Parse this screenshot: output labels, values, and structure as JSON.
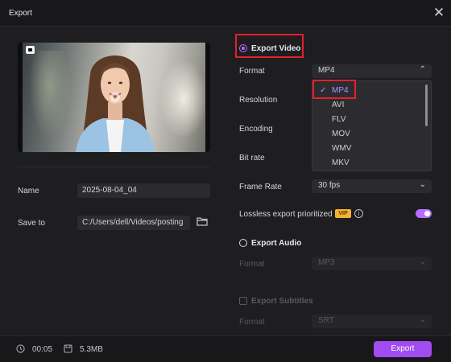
{
  "window": {
    "title": "Export",
    "close_glyph": "✕"
  },
  "left": {
    "name_label": "Name",
    "name_value": "2025-08-04_04",
    "save_label": "Save to",
    "save_value": "C:/Users/dell/Videos/posting"
  },
  "video": {
    "section": "Export Video",
    "selected": true,
    "format_label": "Format",
    "format_value": "MP4",
    "resolution_label": "Resolution",
    "encoding_label": "Encoding",
    "bitrate_label": "Bit rate",
    "framerate_label": "Frame Rate",
    "framerate_value": "30  fps",
    "lossless_label": "Lossless export prioritized",
    "vip_badge": "VIP",
    "lossless_on": true,
    "format_options": [
      "MP4",
      "AVI",
      "FLV",
      "MOV",
      "WMV",
      "MKV"
    ],
    "format_selected_index": 0
  },
  "audio": {
    "section": "Export Audio",
    "format_label": "Format",
    "format_value": "MP3"
  },
  "subtitles": {
    "section": "Export Subtitles",
    "format_label": "Format",
    "format_value": "SRT"
  },
  "footer": {
    "duration": "00:05",
    "size": "5.3MB",
    "export_label": "Export"
  },
  "icons": {
    "close": "close-icon",
    "folder": "folder-icon",
    "clock": "clock-icon",
    "file_size": "file-size-icon",
    "info": "info-icon",
    "check": "checkmark-icon",
    "chevron": "chevron-icon"
  },
  "colors": {
    "accent": "#a14bf0",
    "highlight_box": "#e5202a",
    "vip": "#f2b231",
    "background": "#1e1e21"
  }
}
